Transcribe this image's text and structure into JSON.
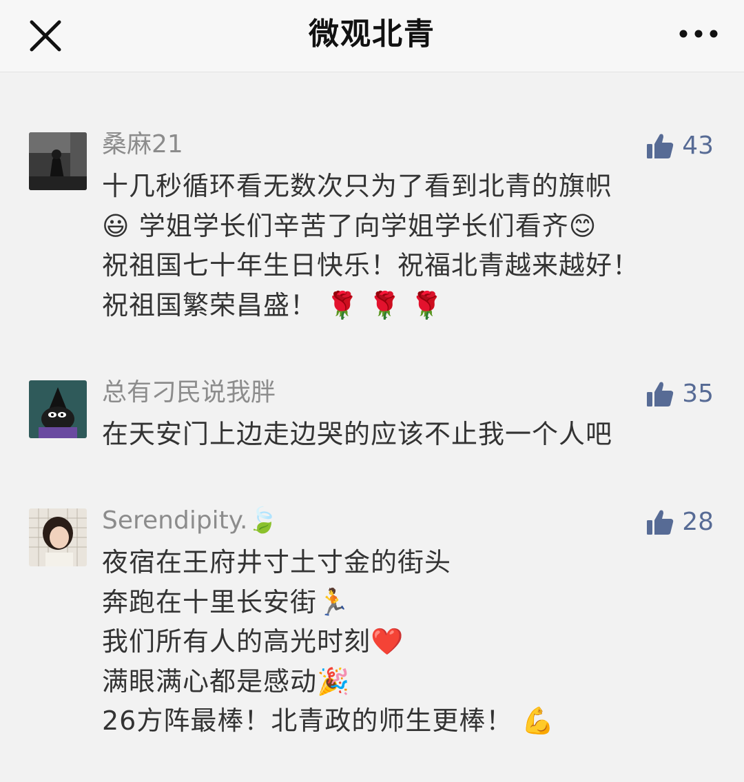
{
  "header": {
    "title": "微观北青"
  },
  "comments": [
    {
      "nickname": "桑麻21",
      "likes": "43",
      "lines": [
        "十几秒循环看无数次只为了看到北青的旗帜",
        "😃 学姐学长们辛苦了向学姐学长们看齐😊",
        "祝祖国七十年生日快乐！祝福北青越来越好！",
        "祝祖国繁荣昌盛！ 🌹 🌹 🌹"
      ]
    },
    {
      "nickname": "总有刁民说我胖",
      "likes": "35",
      "lines": [
        "在天安门上边走边哭的应该不止我一个人吧"
      ]
    },
    {
      "nickname": "Serendipity.🍃",
      "likes": "28",
      "lines": [
        "夜宿在王府井寸土寸金的街头",
        "奔跑在十里长安街🏃",
        "我们所有人的高光时刻❤️",
        "满眼满心都是感动🎉",
        "26方阵最棒！北青政的师生更棒！ 💪"
      ]
    }
  ],
  "colors": {
    "like_blue": "#576b95",
    "nickname_gray": "#8c8c8c",
    "text": "#333333",
    "background": "#f2f2f2"
  },
  "icons": {
    "close": "close-icon",
    "more": "more-icon",
    "like": "thumbs-up-icon"
  }
}
